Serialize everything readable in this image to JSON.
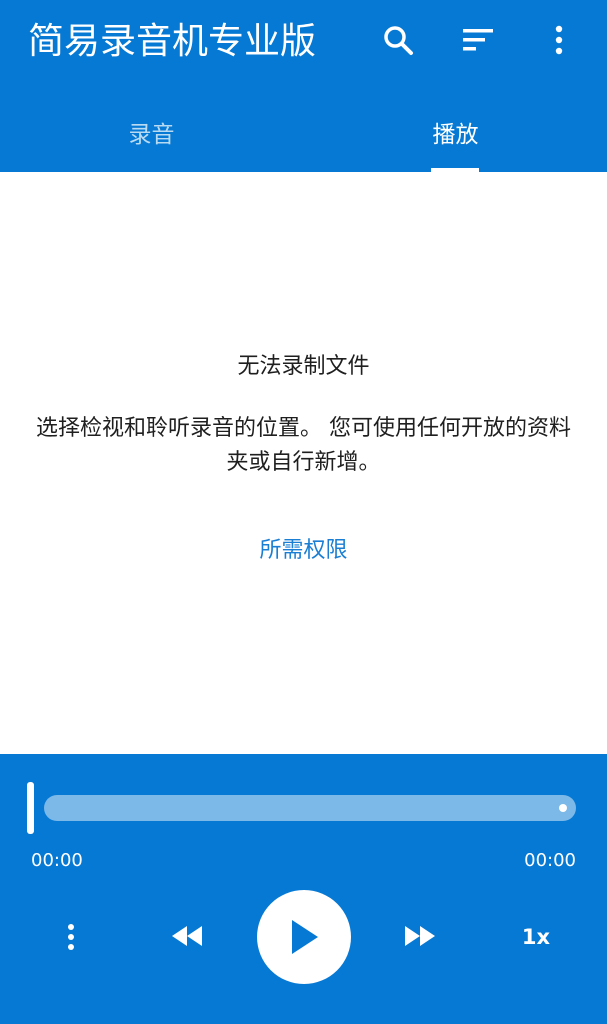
{
  "appbar": {
    "title": "简易录音机专业版",
    "icons": [
      "search-icon",
      "sort-icon",
      "more-vert-icon"
    ],
    "color": "#0679d4"
  },
  "tabs": [
    {
      "label": "录音",
      "active": false
    },
    {
      "label": "播放",
      "active": true
    }
  ],
  "message": {
    "title": "无法录制文件",
    "body": "选择检视和聆听录音的位置。 您可使用任何开放的资料夹或自行新增。",
    "link": "所需权限"
  },
  "player": {
    "current_time": "00:00",
    "total_time": "00:00",
    "progress": 0,
    "speed": "1x",
    "controls": [
      "more-vert-icon",
      "rewind-icon",
      "play-icon",
      "fast-forward-icon"
    ]
  }
}
